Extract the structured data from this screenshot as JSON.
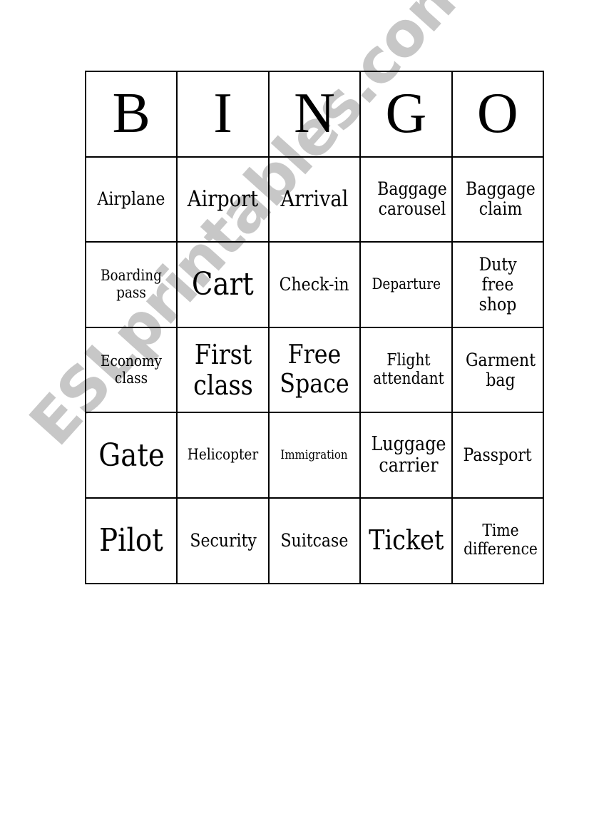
{
  "header": [
    "B",
    "I",
    "N",
    "G",
    "O"
  ],
  "rows": [
    [
      "Airplane",
      "Airport",
      "Arrival",
      "Baggage carousel",
      "Baggage claim"
    ],
    [
      "Boarding pass",
      "Cart",
      "Check-in",
      "Departure",
      "Duty free shop"
    ],
    [
      "Economy class",
      "First class",
      "Free Space",
      "Flight attendant",
      "Garment bag"
    ],
    [
      "Gate",
      "Helicopter",
      "Immigration",
      "Luggage carrier",
      "Passport"
    ],
    [
      "Pilot",
      "Security",
      "Suitcase",
      "Ticket",
      "Time difference"
    ]
  ],
  "watermark": "ESLprintables.com",
  "colors": {
    "text": "#000000",
    "border": "#000000",
    "watermark": "#b8b8b8",
    "background": "#ffffff"
  }
}
